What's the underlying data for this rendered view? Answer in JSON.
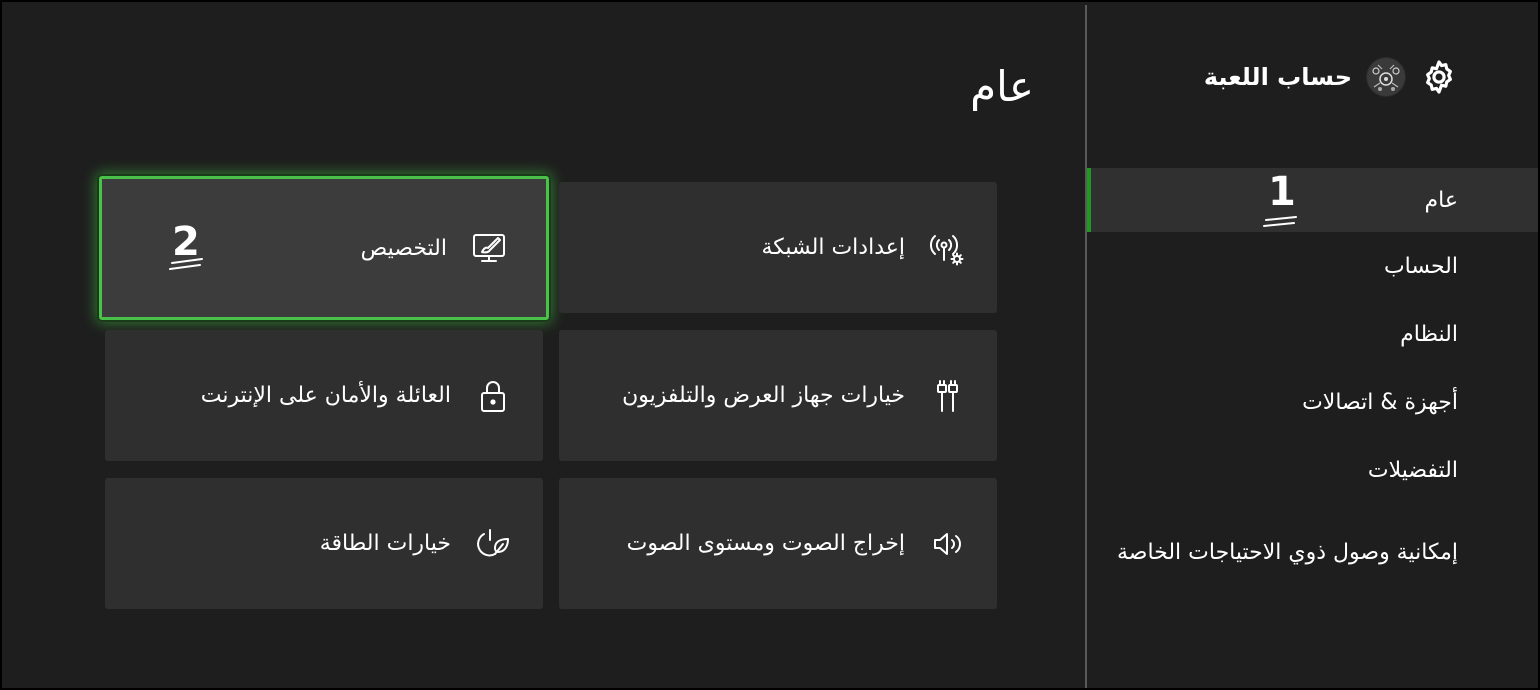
{
  "sidebar": {
    "profile_name": "حساب اللعبة",
    "items": [
      {
        "label": "عام",
        "active": true
      },
      {
        "label": "الحساب"
      },
      {
        "label": "النظام"
      },
      {
        "label": "أجهزة & اتصالات"
      },
      {
        "label": "التفضيلات"
      },
      {
        "label": "إمكانية وصول ذوي الاحتياجات الخاصة"
      }
    ],
    "step_marker": "1"
  },
  "main": {
    "title": "عام",
    "tiles": [
      {
        "label": "التخصيص",
        "icon": "personalize-icon",
        "selected": true
      },
      {
        "label": "إعدادات الشبكة",
        "icon": "network-settings-icon"
      },
      {
        "label": "العائلة والأمان على الإنترنت",
        "icon": "lock-icon"
      },
      {
        "label": "خيارات جهاز العرض والتلفزيون",
        "icon": "tv-display-icon"
      },
      {
        "label": "خيارات الطاقة",
        "icon": "power-leaf-icon"
      },
      {
        "label": "إخراج الصوت ومستوى الصوت",
        "icon": "speaker-icon"
      }
    ],
    "step_marker": "2"
  },
  "colors": {
    "background": "#1e1e1e",
    "tile": "#2f2f2f",
    "accent_green": "#1e9b1e",
    "focus_border": "#4ac24a"
  }
}
